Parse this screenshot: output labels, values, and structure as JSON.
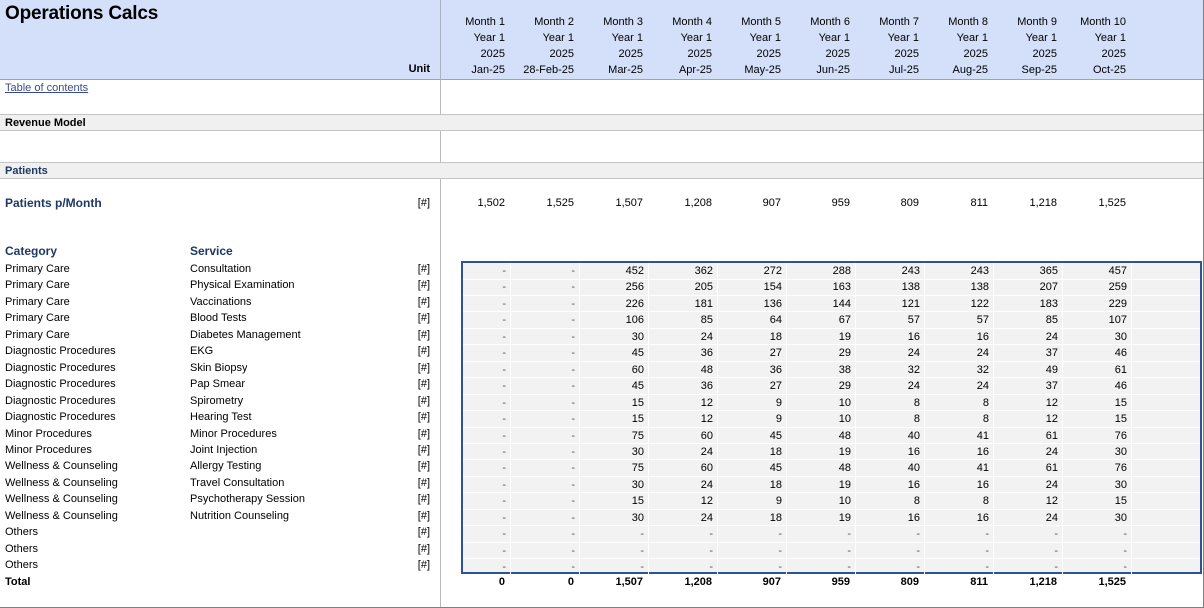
{
  "sheet": {
    "title": "Operations Calcs",
    "unit_header": "Unit",
    "toc_link": "Table of contents",
    "section_revenue_model": "Revenue Model",
    "section_patients": "Patients",
    "patients_per_month_label": "Patients p/Month",
    "category_header": "Category",
    "service_header": "Service",
    "total_label": "Total",
    "unit_symbol": "[#]",
    "dash": "-",
    "accent_blue": "#1f3864",
    "border_blue": "#2e5395",
    "banner_bg": "#d4dffa",
    "band_bg": "#f0f0f0",
    "grid_bg": "#f2f2f2",
    "link_color": "#3b4b8f"
  },
  "columns": [
    {
      "month": "Month 1",
      "year": "Year 1",
      "calendar_year": "2025",
      "date": "Jan-25"
    },
    {
      "month": "Month 2",
      "year": "Year 1",
      "calendar_year": "2025",
      "date": "28-Feb-25"
    },
    {
      "month": "Month 3",
      "year": "Year 1",
      "calendar_year": "2025",
      "date": "Mar-25"
    },
    {
      "month": "Month 4",
      "year": "Year 1",
      "calendar_year": "2025",
      "date": "Apr-25"
    },
    {
      "month": "Month 5",
      "year": "Year 1",
      "calendar_year": "2025",
      "date": "May-25"
    },
    {
      "month": "Month 6",
      "year": "Year 1",
      "calendar_year": "2025",
      "date": "Jun-25"
    },
    {
      "month": "Month 7",
      "year": "Year 1",
      "calendar_year": "2025",
      "date": "Jul-25"
    },
    {
      "month": "Month 8",
      "year": "Year 1",
      "calendar_year": "2025",
      "date": "Aug-25"
    },
    {
      "month": "Month 9",
      "year": "Year 1",
      "calendar_year": "2025",
      "date": "Sep-25"
    },
    {
      "month": "Month 10",
      "year": "Year 1",
      "calendar_year": "2025",
      "date": "Oct-25"
    }
  ],
  "patients_per_month": [
    "1,502",
    "1,525",
    "1,507",
    "1,208",
    "907",
    "959",
    "809",
    "811",
    "1,218",
    "1,525"
  ],
  "rows": [
    {
      "category": "Primary Care",
      "service": "Consultation",
      "unit": "[#]",
      "values": [
        "-",
        "-",
        "452",
        "362",
        "272",
        "288",
        "243",
        "243",
        "365",
        "457"
      ]
    },
    {
      "category": "Primary Care",
      "service": "Physical Examination",
      "unit": "[#]",
      "values": [
        "-",
        "-",
        "256",
        "205",
        "154",
        "163",
        "138",
        "138",
        "207",
        "259"
      ]
    },
    {
      "category": "Primary Care",
      "service": "Vaccinations",
      "unit": "[#]",
      "values": [
        "-",
        "-",
        "226",
        "181",
        "136",
        "144",
        "121",
        "122",
        "183",
        "229"
      ]
    },
    {
      "category": "Primary Care",
      "service": "Blood Tests",
      "unit": "[#]",
      "values": [
        "-",
        "-",
        "106",
        "85",
        "64",
        "67",
        "57",
        "57",
        "85",
        "107"
      ]
    },
    {
      "category": "Primary Care",
      "service": "Diabetes Management",
      "unit": "[#]",
      "values": [
        "-",
        "-",
        "30",
        "24",
        "18",
        "19",
        "16",
        "16",
        "24",
        "30"
      ]
    },
    {
      "category": "Diagnostic Procedures",
      "service": "EKG",
      "unit": "[#]",
      "values": [
        "-",
        "-",
        "45",
        "36",
        "27",
        "29",
        "24",
        "24",
        "37",
        "46"
      ]
    },
    {
      "category": "Diagnostic Procedures",
      "service": "Skin Biopsy",
      "unit": "[#]",
      "values": [
        "-",
        "-",
        "60",
        "48",
        "36",
        "38",
        "32",
        "32",
        "49",
        "61"
      ]
    },
    {
      "category": "Diagnostic Procedures",
      "service": "Pap Smear",
      "unit": "[#]",
      "values": [
        "-",
        "-",
        "45",
        "36",
        "27",
        "29",
        "24",
        "24",
        "37",
        "46"
      ]
    },
    {
      "category": "Diagnostic Procedures",
      "service": "Spirometry",
      "unit": "[#]",
      "values": [
        "-",
        "-",
        "15",
        "12",
        "9",
        "10",
        "8",
        "8",
        "12",
        "15"
      ]
    },
    {
      "category": "Diagnostic Procedures",
      "service": "Hearing Test",
      "unit": "[#]",
      "values": [
        "-",
        "-",
        "15",
        "12",
        "9",
        "10",
        "8",
        "8",
        "12",
        "15"
      ]
    },
    {
      "category": "Minor Procedures",
      "service": "Minor Procedures",
      "unit": "[#]",
      "values": [
        "-",
        "-",
        "75",
        "60",
        "45",
        "48",
        "40",
        "41",
        "61",
        "76"
      ]
    },
    {
      "category": "Minor Procedures",
      "service": "Joint Injection",
      "unit": "[#]",
      "values": [
        "-",
        "-",
        "30",
        "24",
        "18",
        "19",
        "16",
        "16",
        "24",
        "30"
      ]
    },
    {
      "category": "Wellness & Counseling",
      "service": "Allergy Testing",
      "unit": "[#]",
      "values": [
        "-",
        "-",
        "75",
        "60",
        "45",
        "48",
        "40",
        "41",
        "61",
        "76"
      ]
    },
    {
      "category": "Wellness & Counseling",
      "service": "Travel Consultation",
      "unit": "[#]",
      "values": [
        "-",
        "-",
        "30",
        "24",
        "18",
        "19",
        "16",
        "16",
        "24",
        "30"
      ]
    },
    {
      "category": "Wellness & Counseling",
      "service": "Psychotherapy Session",
      "unit": "[#]",
      "values": [
        "-",
        "-",
        "15",
        "12",
        "9",
        "10",
        "8",
        "8",
        "12",
        "15"
      ]
    },
    {
      "category": "Wellness & Counseling",
      "service": "Nutrition Counseling",
      "unit": "[#]",
      "values": [
        "-",
        "-",
        "30",
        "24",
        "18",
        "19",
        "16",
        "16",
        "24",
        "30"
      ]
    },
    {
      "category": "Others",
      "service": "",
      "unit": "[#]",
      "values": [
        "-",
        "-",
        "-",
        "-",
        "-",
        "-",
        "-",
        "-",
        "-",
        "-"
      ]
    },
    {
      "category": "Others",
      "service": "",
      "unit": "[#]",
      "values": [
        "-",
        "-",
        "-",
        "-",
        "-",
        "-",
        "-",
        "-",
        "-",
        "-"
      ]
    },
    {
      "category": "Others",
      "service": "",
      "unit": "[#]",
      "values": [
        "-",
        "-",
        "-",
        "-",
        "-",
        "-",
        "-",
        "-",
        "-",
        "-"
      ]
    }
  ],
  "totals": [
    "0",
    "0",
    "1,507",
    "1,208",
    "907",
    "959",
    "809",
    "811",
    "1,218",
    "1,525"
  ]
}
